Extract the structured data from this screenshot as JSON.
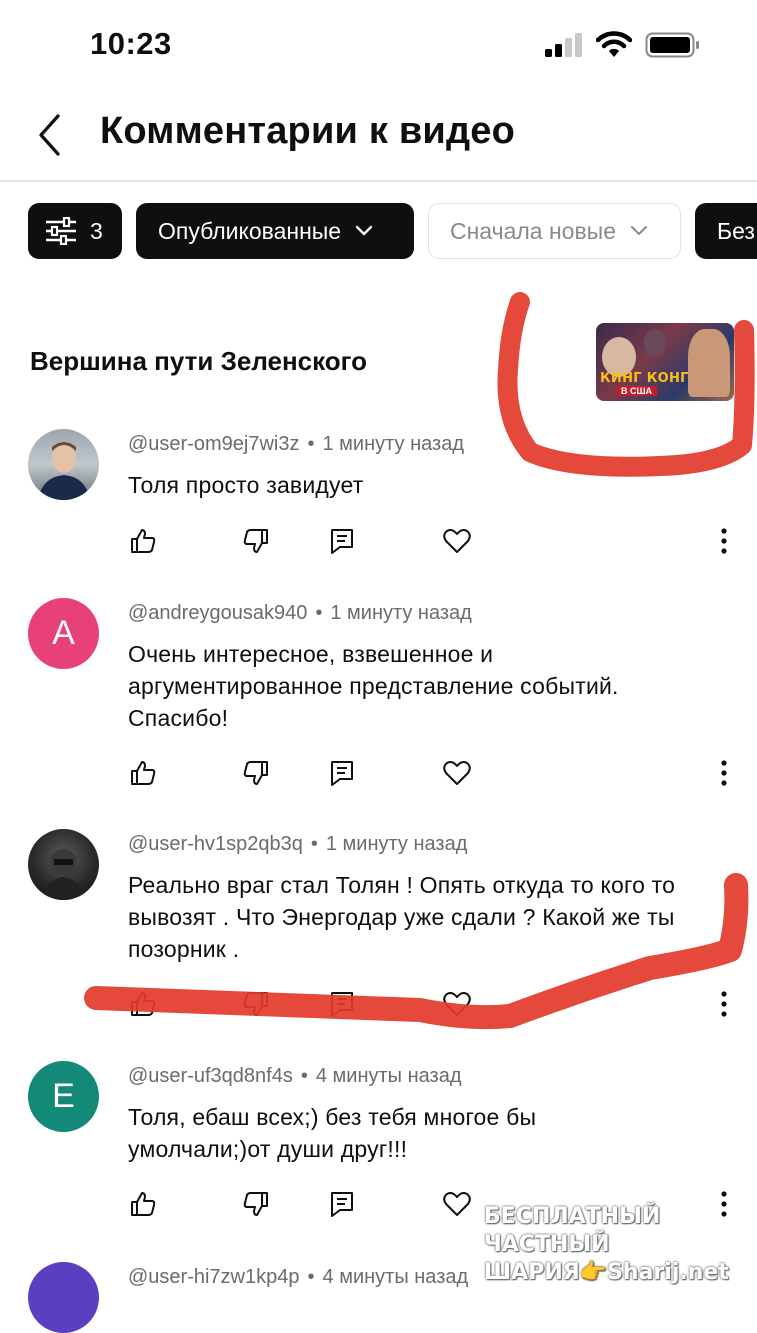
{
  "status_bar": {
    "time": "10:23"
  },
  "header": {
    "title": "Комментарии к видео"
  },
  "filters": {
    "filter_count": "3",
    "status": "Опубликованные",
    "sort": "Сначала новые",
    "more": "Без"
  },
  "video": {
    "title": "Вершина пути Зеленского",
    "thumb_text_main": "КИНГ КОНГ",
    "thumb_text_sub": "В США"
  },
  "comments": [
    {
      "author": "@user-om9ej7wi3z",
      "time": "1 минуту назад",
      "text": "Толя просто завидует",
      "avatar_type": "photo"
    },
    {
      "author": "@andreygousak940",
      "time": "1 минуту назад",
      "text": "Очень интересное, взвешенное и аргументированное представление событий. Спасибо!",
      "avatar_letter": "A",
      "avatar_color": "#e8407a"
    },
    {
      "author": "@user-hv1sp2qb3q",
      "time": "1 минуту назад",
      "text": "Реально враг стал Толян ! Опять откуда то кого то вывозят . Что Энергодар уже сдали ? Какой же ты позорник .",
      "avatar_type": "photo"
    },
    {
      "author": "@user-uf3qd8nf4s",
      "time": "4 минуты назад",
      "text": "Толя, ебаш всех;) без тебя многое бы умолчали;)от души друг!!!",
      "avatar_letter": "E",
      "avatar_color": "#128a77"
    },
    {
      "author": "@user-hi7zw1kp4p",
      "time": "4 минуты назад",
      "avatar_color": "#5a3fc0"
    }
  ],
  "watermark": {
    "line1": "БЕСПЛАТНЫЙ ЧАСТНЫЙ",
    "line2": "ШАРИЯ👉Sharij.net"
  },
  "colors": {
    "annotation": "#e23a2a",
    "text_primary": "#0f0f0f",
    "text_secondary": "#6b6b6b"
  }
}
